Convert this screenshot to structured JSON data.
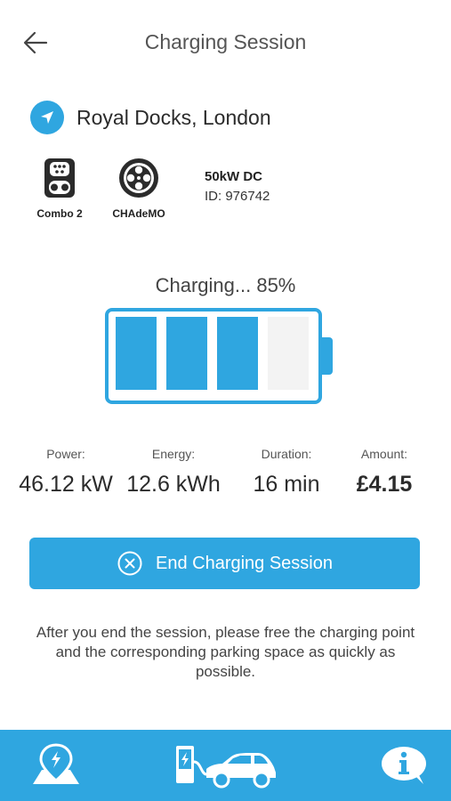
{
  "header": {
    "title": "Charging Session",
    "back_icon": "arrow-left-icon"
  },
  "location": {
    "icon": "navigation-arrow-icon",
    "name": "Royal Docks, London"
  },
  "connectors": [
    {
      "label": "Combo 2",
      "icon": "combo2-connector-icon"
    },
    {
      "label": "CHAdeMO",
      "icon": "chademo-connector-icon"
    }
  ],
  "charger": {
    "power": "50kW DC",
    "id": "ID: 976742"
  },
  "charging": {
    "status_text": "Charging... 85%",
    "level_percent": 85,
    "cells_filled": 3,
    "cells_total": 4
  },
  "stats": {
    "power": {
      "label": "Power:",
      "value": "46.12 kW"
    },
    "energy": {
      "label": "Energy:",
      "value": "12.6 kWh"
    },
    "duration": {
      "label": "Duration:",
      "value": "16 min"
    },
    "amount": {
      "label": "Amount:",
      "value": "£4.15"
    }
  },
  "end_button": {
    "label": "End Charging Session",
    "icon": "close-circle-icon"
  },
  "note": "After you end the session, please free the charging point and the corresponding parking space as quickly as possible.",
  "bottom_nav": [
    {
      "name": "map",
      "icon": "map-pin-charging-icon"
    },
    {
      "name": "charging",
      "icon": "charger-car-icon"
    },
    {
      "name": "info",
      "icon": "info-bubble-icon"
    }
  ],
  "colors": {
    "accent": "#2fa6e0",
    "empty_cell": "#f3f3f3",
    "text": "#333333"
  }
}
